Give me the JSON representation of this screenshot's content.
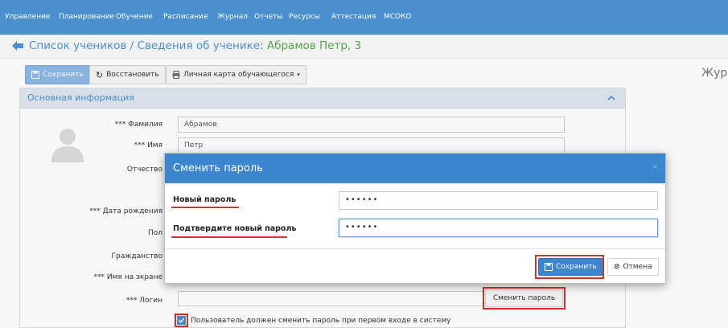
{
  "topnav": {
    "items": [
      "Управление",
      "Планирование",
      "Обучение",
      "Расписание",
      "Журнал",
      "Отчеты",
      "Ресурсы",
      "Аттестация",
      "МСОКО"
    ]
  },
  "titlebar": {
    "title_prefix": "Список учеников / Сведения об ученике: ",
    "title_student": "Абрамов Петр, 3"
  },
  "toolbar": {
    "save_label": "Сохранить",
    "restore_label": "Восстановить",
    "card_label": "Личная карта обучающегося"
  },
  "right_label": "Жур",
  "card": {
    "header": "Основная информация",
    "labels": {
      "lastname": "*** Фамилия",
      "firstname": "*** Имя",
      "patronymic": "Отчество",
      "birthdate": "*** Дата рождения",
      "gender": "Пол",
      "citizenship": "Гражданство",
      "screenname": "*** Имя на экране",
      "login": "*** Логин"
    },
    "values": {
      "lastname": "Абрамов",
      "firstname": "Петр"
    },
    "change_password_label": "Сменить пароль",
    "must_change_label": "Пользователь должен сменить пароль при первом входе в систему"
  },
  "modal": {
    "title": "Сменить пароль",
    "close": "×",
    "new_password_label": "Новый пароль",
    "new_password_value": "••••••",
    "confirm_label": "Подтвердите новый пароль",
    "confirm_value": "••••••",
    "save_label": "Сохранить",
    "cancel_label": "Отмена"
  },
  "colors": {
    "nav_bg": "#4a8fd0",
    "accent_blue": "#3b86cf",
    "highlight_red": "#d9302a",
    "name_green": "#54a44c"
  }
}
